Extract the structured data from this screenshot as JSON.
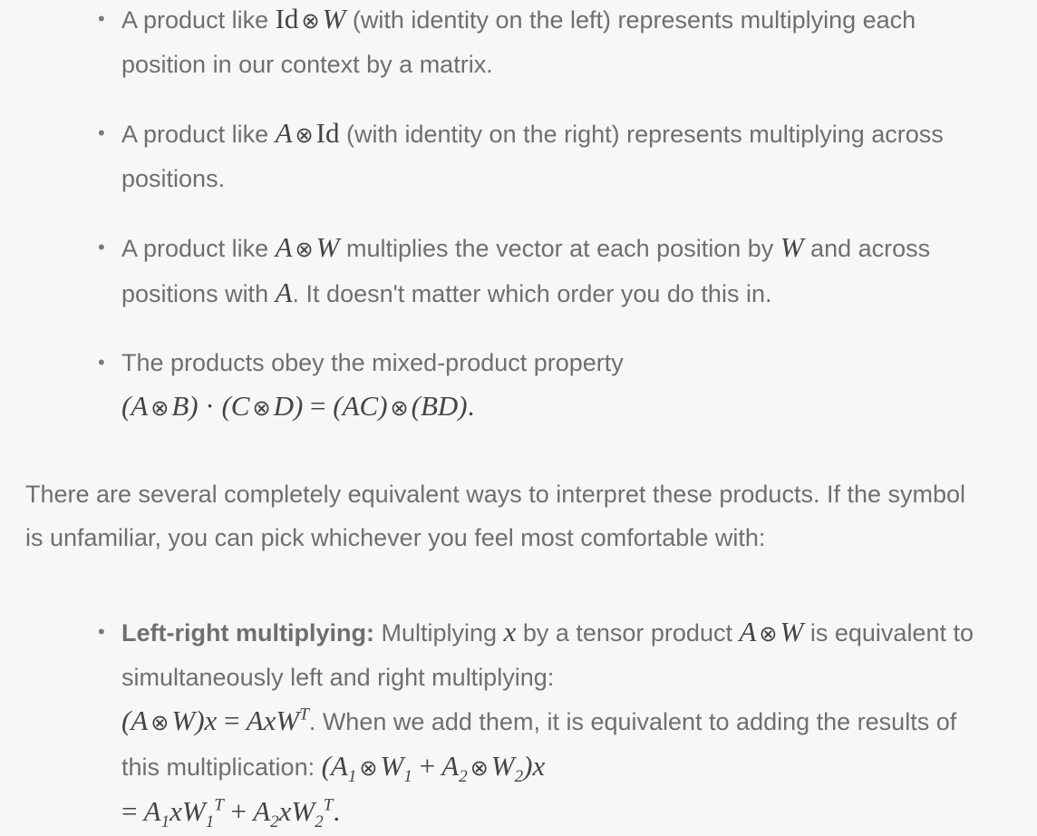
{
  "list1": {
    "item1": {
      "prefix": "A product like",
      "math": "Id ⊗ W",
      "suffix": "(with identity on the left) represents multiplying each position in our context by a matrix."
    },
    "item2": {
      "prefix": "A product like",
      "math": "A ⊗ Id",
      "suffix": "(with identity on the right) represents multiplying across positions."
    },
    "item3": {
      "prefix": "A product like",
      "math": "A ⊗ W",
      "middle": "multiplies the vector at each position by",
      "math2": "W",
      "middle2": "and across positions with",
      "math3": "A",
      "suffix": ". It doesn't matter which order you do this in."
    },
    "item4": {
      "text": "The products obey the mixed-product property",
      "equation": "(A ⊗ B) · (C ⊗ D) = (AC) ⊗ (BD)."
    }
  },
  "paragraph": "There are several completely equivalent ways to interpret these products. If the symbol is unfamiliar, you can pick whichever you feel most comfortable with:",
  "list2": {
    "item1": {
      "bold": "Left-right multiplying:",
      "text1": "Multiplying",
      "math1": "x",
      "text2": "by a tensor product",
      "math2": "A ⊗ W",
      "text3": "is equivalent to simultaneously left and right multiplying:",
      "eq1": "(A ⊗ W)x = AxW",
      "eq1_sup": "T",
      "text4": ". When we add them, it is equivalent to adding the results of this multiplication:",
      "eq2": "(A₁ ⊗ W₁ + A₂ ⊗ W₂)x",
      "eq3": "= A₁xW₁ᵀ + A₂xW₂ᵀ",
      "eq3_end": "."
    }
  }
}
